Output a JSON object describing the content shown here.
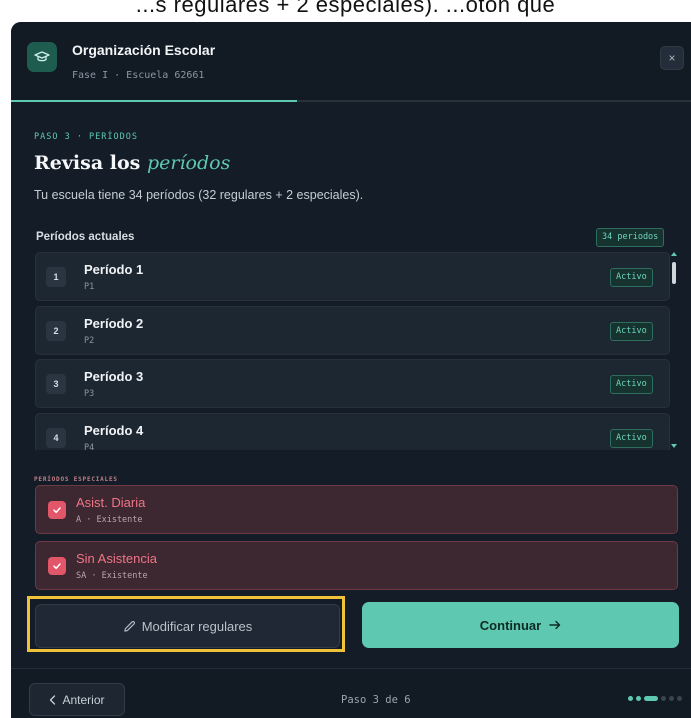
{
  "top_strip": {
    "text": "...s regulares + 2 especiales). ...otón que"
  },
  "header": {
    "logo_icon": "graduation-cap-icon",
    "title": "Organización Escolar",
    "subtitle": "Fase I · Escuela 62661",
    "close_label": "×",
    "progress": 0.42
  },
  "step": {
    "label": "PASO 3 · PERÍODOS",
    "heading_plain": "Revisa los ",
    "heading_em": "períodos",
    "description": "Tu escuela tiene 34 períodos (32 regulares + 2 especiales)."
  },
  "current_periods": {
    "title": "Períodos actuales",
    "count_badge": "34 periodos",
    "rows": [
      {
        "num": "1",
        "name": "Período 1",
        "code": "P1",
        "status": "Activo"
      },
      {
        "num": "2",
        "name": "Período 2",
        "code": "P2",
        "status": "Activo"
      },
      {
        "num": "3",
        "name": "Período 3",
        "code": "P3",
        "status": "Activo"
      },
      {
        "num": "4",
        "name": "Período 4",
        "code": "P4",
        "status": "Activo"
      }
    ]
  },
  "special_periods": {
    "title": "PERÍODOS ESPECIALES",
    "rows": [
      {
        "name": "Asist. Diaria",
        "code": "A · Existente",
        "checked": true
      },
      {
        "name": "Sin Asistencia",
        "code": "SA · Existente",
        "checked": true
      }
    ]
  },
  "actions": {
    "modify_label": "Modificar regulares",
    "modify_icon": "pencil-icon",
    "continue_label": "Continuar",
    "continue_icon": "arrow-right-icon"
  },
  "footer": {
    "prev_label": "Anterior",
    "prev_icon": "chevron-left-icon",
    "step_text": "Paso 3 de 6",
    "total_steps": 6,
    "current_step": 3
  },
  "colors": {
    "accent": "#5ec9b0",
    "danger": "#f07585",
    "highlight": "#f0c23a",
    "background": "#141d27"
  }
}
